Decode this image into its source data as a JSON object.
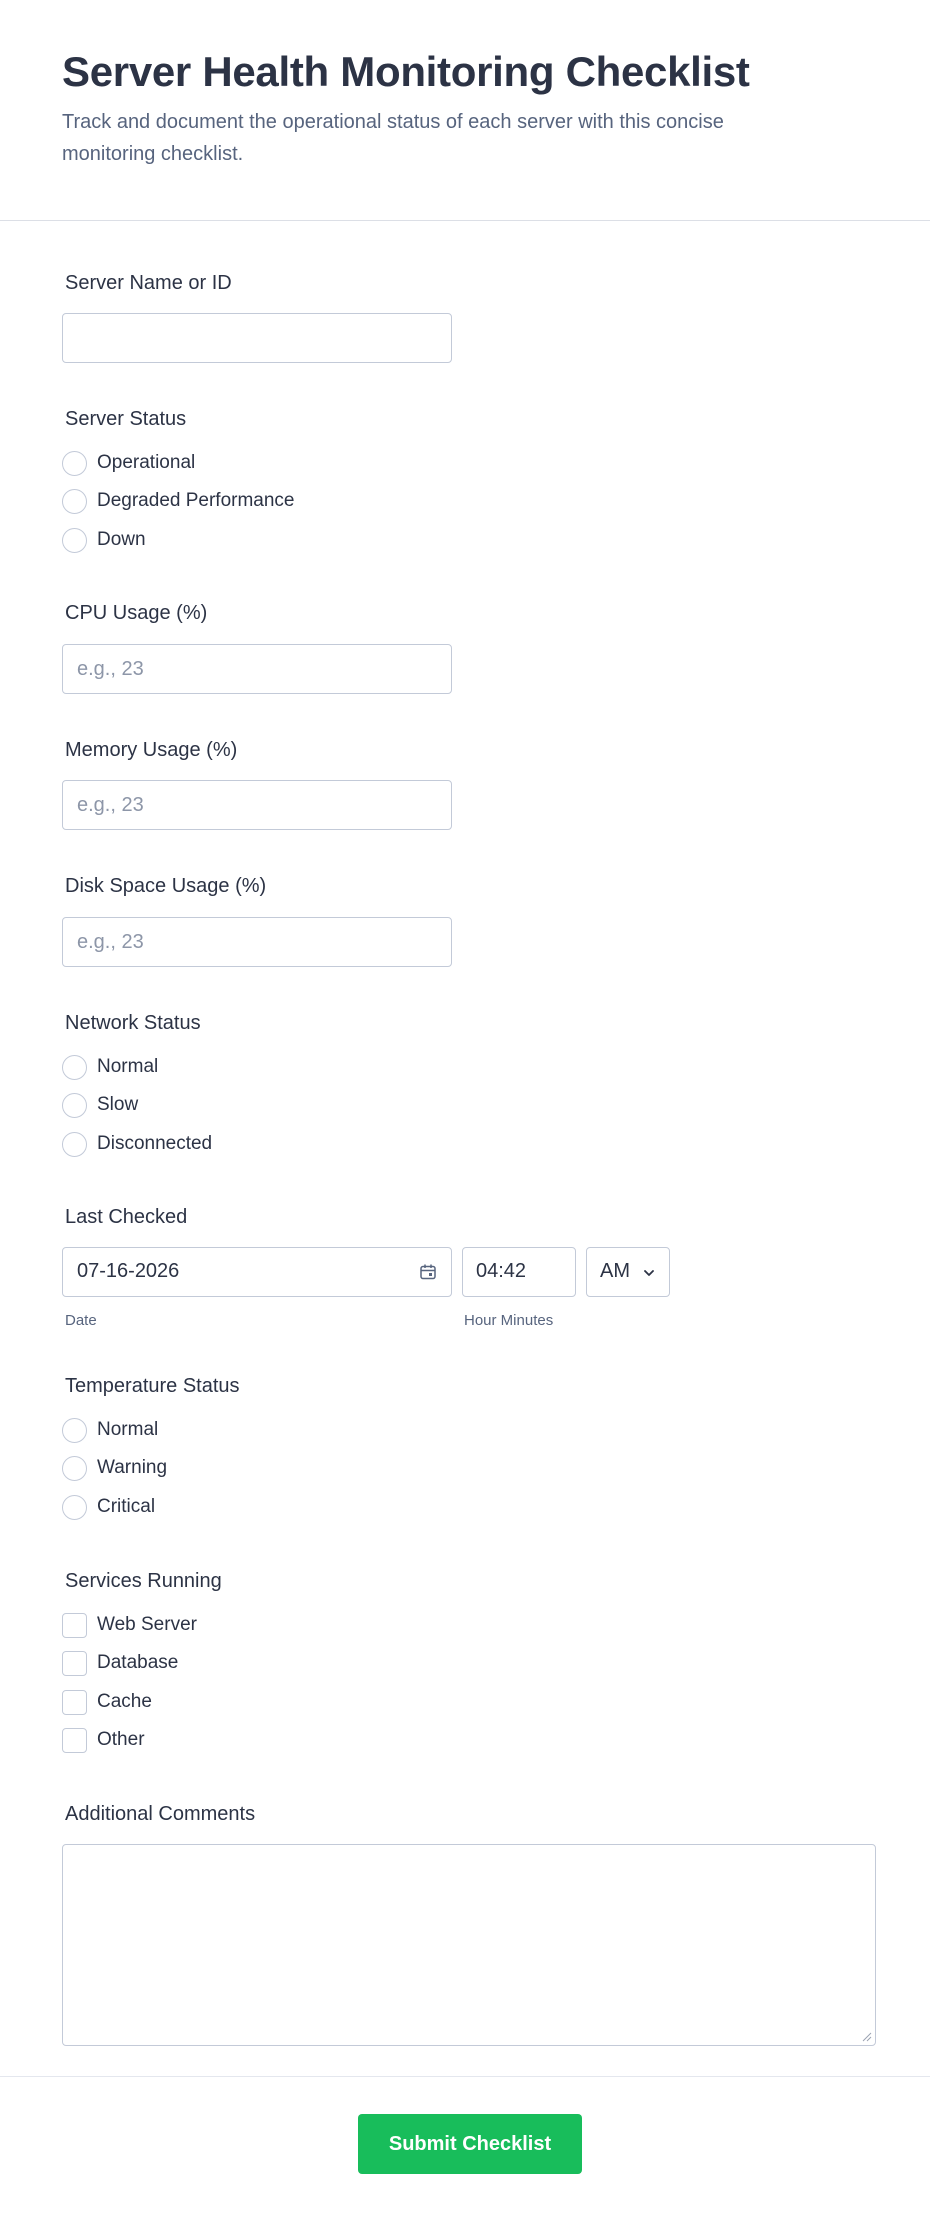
{
  "header": {
    "title": "Server Health Monitoring Checklist",
    "subtitle": "Track and document the operational status of each server with this concise monitoring checklist."
  },
  "server_name": {
    "label": "Server Name or ID",
    "value": "",
    "placeholder": ""
  },
  "server_status": {
    "label": "Server Status",
    "options": [
      "Operational",
      "Degraded Performance",
      "Down"
    ]
  },
  "cpu_usage": {
    "label": "CPU Usage (%)",
    "placeholder": "e.g., 23"
  },
  "memory_usage": {
    "label": "Memory Usage (%)",
    "placeholder": "e.g., 23"
  },
  "disk_usage": {
    "label": "Disk Space Usage (%)",
    "placeholder": "e.g., 23"
  },
  "network_status": {
    "label": "Network Status",
    "options": [
      "Normal",
      "Slow",
      "Disconnected"
    ]
  },
  "last_checked": {
    "label": "Last Checked",
    "date_value": "07-16-2026",
    "date_sublabel": "Date",
    "time_value": "04:42",
    "time_sublabel": "Hour Minutes",
    "ampm_value": "AM",
    "icons": {
      "date": "calendar-icon",
      "ampm": "chevron-down-icon"
    }
  },
  "temperature_status": {
    "label": "Temperature Status",
    "options": [
      "Normal",
      "Warning",
      "Critical"
    ]
  },
  "services_running": {
    "label": "Services Running",
    "options": [
      "Web Server",
      "Database",
      "Cache",
      "Other"
    ]
  },
  "comments": {
    "label": "Additional Comments",
    "value": ""
  },
  "submit": {
    "label": "Submit Checklist",
    "color": "#18bd5b"
  }
}
